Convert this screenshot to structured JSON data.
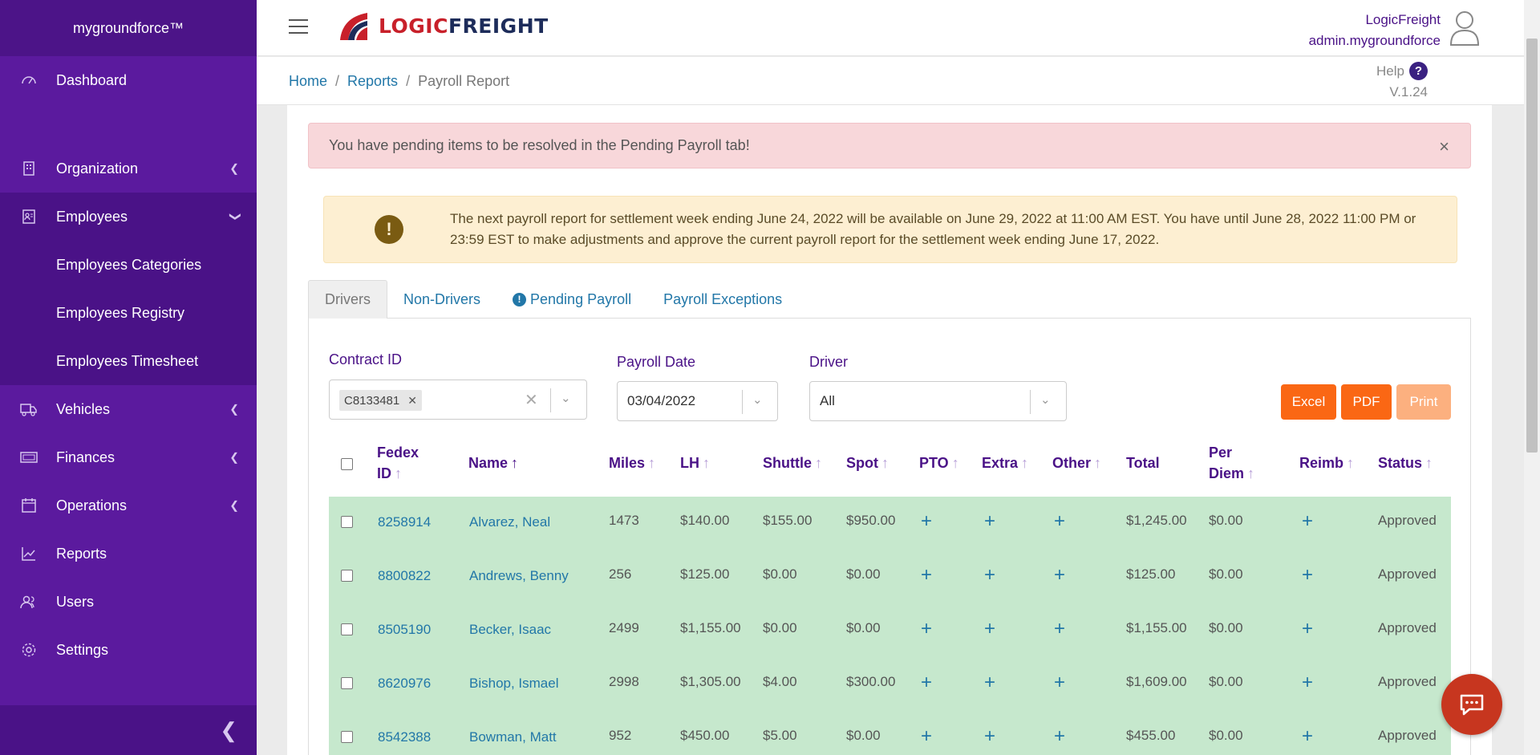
{
  "sidebar": {
    "brand": "mygroundforce™",
    "items": {
      "dashboard": "Dashboard",
      "organization": "Organization",
      "employees": "Employees",
      "employees_categories": "Employees Categories",
      "employees_registry": "Employees Registry",
      "employees_timesheet": "Employees Timesheet",
      "vehicles": "Vehicles",
      "finances": "Finances",
      "operations": "Operations",
      "reports": "Reports",
      "users": "Users",
      "settings": "Settings"
    },
    "icons": {
      "dashboard": "gauge-icon",
      "organization": "building-icon",
      "employees": "id-card-icon",
      "vehicles": "truck-icon",
      "finances": "money-icon",
      "operations": "calendar-icon",
      "reports": "chart-line-icon",
      "users": "users-icon",
      "settings": "gear-icon"
    },
    "collapse_icon": "chevron-left-icon"
  },
  "header": {
    "logo_part1": "LOGIC",
    "logo_part2": "FREIGHT",
    "company": "LogicFreight",
    "username": "admin.mygroundforce"
  },
  "breadcrumb": {
    "home": "Home",
    "reports": "Reports",
    "current": "Payroll Report",
    "separator": "/"
  },
  "help": {
    "label": "Help",
    "icon_text": "?",
    "version": "V.1.24"
  },
  "alerts": {
    "pending": "You have pending items to be resolved in the Pending Payroll tab!",
    "close": "×",
    "info_icon": "!",
    "info": "The next payroll report for settlement week ending June 24, 2022 will be available on June 29, 2022 at 11:00 AM EST. You have until June 28, 2022 11:00 PM or 23:59 EST to make adjustments and approve the current payroll report for the settlement week ending June 17, 2022."
  },
  "tabs": {
    "drivers": "Drivers",
    "non_drivers": "Non-Drivers",
    "pending": "Pending Payroll",
    "pending_icon": "!",
    "exceptions": "Payroll Exceptions"
  },
  "filters": {
    "contract_label": "Contract ID",
    "contract_value": "C8133481",
    "payroll_label": "Payroll Date",
    "payroll_value": "03/04/2022",
    "driver_label": "Driver",
    "driver_value": "All"
  },
  "buttons": {
    "excel": "Excel",
    "pdf": "PDF",
    "print": "Print"
  },
  "colors": {
    "sidebar": "#5b1a9e",
    "accent": "#4a1287",
    "row_approved": "#c6e8cd",
    "btn_orange": "#fa6714",
    "btn_print": "#fcb07f",
    "link": "#2277a8"
  },
  "table": {
    "headers": {
      "fedex_1": "Fedex",
      "fedex_2": "ID",
      "name": "Name",
      "miles": "Miles",
      "lh": "LH",
      "shuttle": "Shuttle",
      "spot": "Spot",
      "pto": "PTO",
      "extra": "Extra",
      "other": "Other",
      "total": "Total",
      "perdiem_1": "Per",
      "perdiem_2": "Diem",
      "reimb": "Reimb",
      "status": "Status"
    },
    "rows": [
      {
        "id": "8258914",
        "name": "Alvarez, Neal",
        "miles": "1473",
        "lh": "$140.00",
        "shuttle": "$155.00",
        "spot": "$950.00",
        "pto": "+",
        "extra": "+",
        "other": "+",
        "total": "$1,245.00",
        "perdiem": "$0.00",
        "reimb": "+",
        "status": "Approved"
      },
      {
        "id": "8800822",
        "name": "Andrews, Benny",
        "miles": "256",
        "lh": "$125.00",
        "shuttle": "$0.00",
        "spot": "$0.00",
        "pto": "+",
        "extra": "+",
        "other": "+",
        "total": "$125.00",
        "perdiem": "$0.00",
        "reimb": "+",
        "status": "Approved"
      },
      {
        "id": "8505190",
        "name": "Becker, Isaac",
        "miles": "2499",
        "lh": "$1,155.00",
        "shuttle": "$0.00",
        "spot": "$0.00",
        "pto": "+",
        "extra": "+",
        "other": "+",
        "total": "$1,155.00",
        "perdiem": "$0.00",
        "reimb": "+",
        "status": "Approved"
      },
      {
        "id": "8620976",
        "name": "Bishop, Ismael",
        "miles": "2998",
        "lh": "$1,305.00",
        "shuttle": "$4.00",
        "spot": "$300.00",
        "pto": "+",
        "extra": "+",
        "other": "+",
        "total": "$1,609.00",
        "perdiem": "$0.00",
        "reimb": "+",
        "status": "Approved"
      },
      {
        "id": "8542388",
        "name": "Bowman, Matt",
        "miles": "952",
        "lh": "$450.00",
        "shuttle": "$5.00",
        "spot": "$0.00",
        "pto": "+",
        "extra": "+",
        "other": "+",
        "total": "$455.00",
        "perdiem": "$0.00",
        "reimb": "+",
        "status": "Approved"
      }
    ]
  },
  "chat_icon": "chat-bubble-icon"
}
